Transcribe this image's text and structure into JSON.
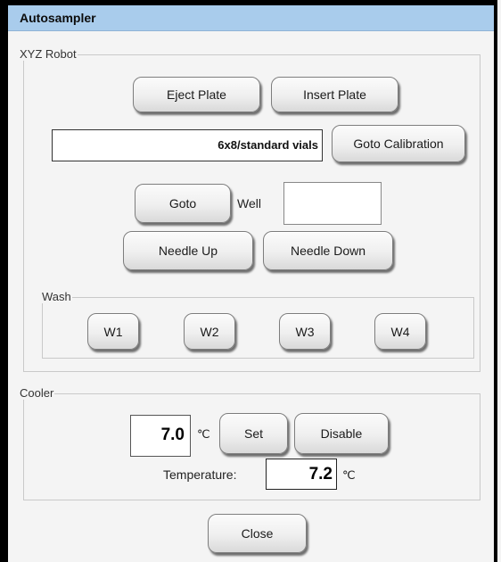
{
  "window": {
    "title": "Autosampler"
  },
  "xyz_robot": {
    "group_label": "XYZ Robot",
    "eject_plate": "Eject Plate",
    "insert_plate": "Insert Plate",
    "plate_type": "6x8/standard vials",
    "goto_calibration": "Goto Calibration",
    "goto": "Goto",
    "well_label": "Well",
    "well_value": "",
    "needle_up": "Needle Up",
    "needle_down": "Needle Down",
    "wash": {
      "group_label": "Wash",
      "buttons": [
        "W1",
        "W2",
        "W3",
        "W4"
      ]
    }
  },
  "cooler": {
    "group_label": "Cooler",
    "setpoint": "7.0",
    "unit": "℃",
    "set": "Set",
    "disable": "Disable",
    "temperature_label": "Temperature:",
    "temperature_value": "7.2"
  },
  "footer": {
    "close": "Close"
  }
}
